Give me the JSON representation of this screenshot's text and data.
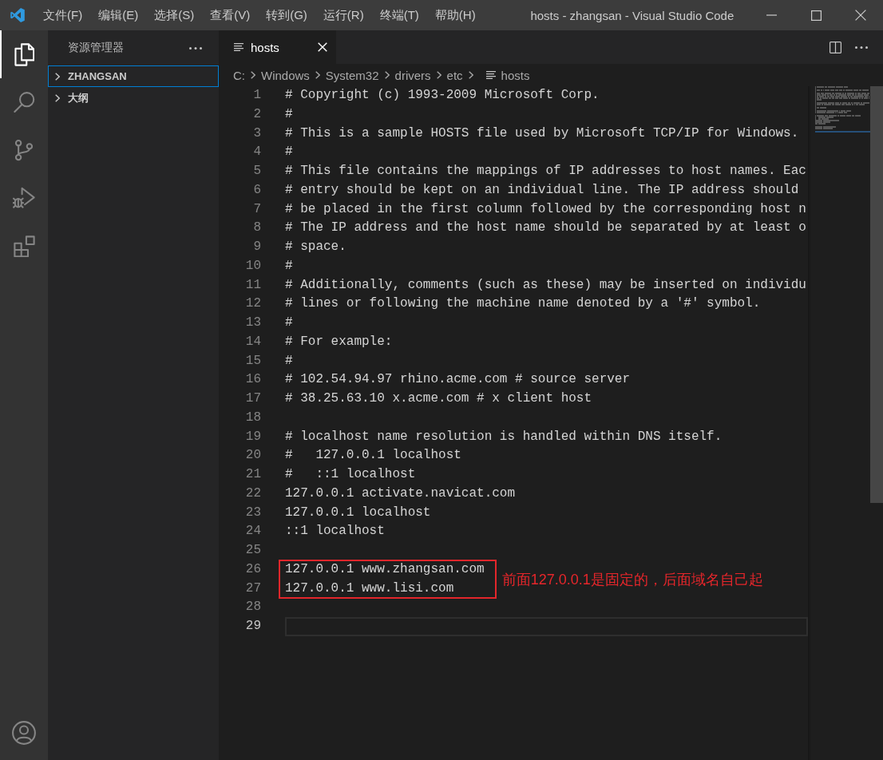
{
  "title_bar": {
    "menu": [
      "文件(F)",
      "编辑(E)",
      "选择(S)",
      "查看(V)",
      "转到(G)",
      "运行(R)",
      "终端(T)",
      "帮助(H)"
    ],
    "title": "hosts - zhangsan - Visual Studio Code"
  },
  "activity_bar": {
    "items": [
      {
        "kind": "explorer",
        "selected": true
      },
      {
        "kind": "search",
        "selected": false
      },
      {
        "kind": "source_control",
        "selected": false
      },
      {
        "kind": "run_debug",
        "selected": false
      },
      {
        "kind": "extensions",
        "selected": false
      }
    ]
  },
  "sidebar": {
    "title": "资源管理器",
    "sections": [
      {
        "label": "ZHANGSAN",
        "expanded": false,
        "selected": true
      },
      {
        "label": "大纲",
        "expanded": false,
        "selected": false
      }
    ]
  },
  "editor": {
    "tabs": [
      {
        "label": "hosts",
        "selected": true
      }
    ],
    "breadcrumb": [
      {
        "label": "C:",
        "kind": "folder"
      },
      {
        "label": "Windows",
        "kind": "folder"
      },
      {
        "label": "System32",
        "kind": "folder"
      },
      {
        "label": "drivers",
        "kind": "folder"
      },
      {
        "label": "etc",
        "kind": "folder"
      },
      {
        "label": "hosts",
        "kind": "file"
      }
    ],
    "lines": [
      {
        "number": "1",
        "text": "# Copyright (c) 1993-2009 Microsoft Corp.",
        "current": false,
        "boxed": false
      },
      {
        "number": "2",
        "text": "#",
        "current": false,
        "boxed": false
      },
      {
        "number": "3",
        "text": "# This is a sample HOSTS file used by Microsoft TCP/IP for Windows.",
        "current": false,
        "boxed": false
      },
      {
        "number": "4",
        "text": "#",
        "current": false,
        "boxed": false
      },
      {
        "number": "5",
        "text": "# This file contains the mappings of IP addresses to host names. Eac",
        "current": false,
        "boxed": false
      },
      {
        "number": "6",
        "text": "# entry should be kept on an individual line. The IP address should",
        "current": false,
        "boxed": false
      },
      {
        "number": "7",
        "text": "# be placed in the first column followed by the corresponding host n",
        "current": false,
        "boxed": false
      },
      {
        "number": "8",
        "text": "# The IP address and the host name should be separated by at least o",
        "current": false,
        "boxed": false
      },
      {
        "number": "9",
        "text": "# space.",
        "current": false,
        "boxed": false
      },
      {
        "number": "10",
        "text": "#",
        "current": false,
        "boxed": false
      },
      {
        "number": "11",
        "text": "# Additionally, comments (such as these) may be inserted on individu",
        "current": false,
        "boxed": false
      },
      {
        "number": "12",
        "text": "# lines or following the machine name denoted by a '#' symbol.",
        "current": false,
        "boxed": false
      },
      {
        "number": "13",
        "text": "#",
        "current": false,
        "boxed": false
      },
      {
        "number": "14",
        "text": "# For example:",
        "current": false,
        "boxed": false
      },
      {
        "number": "15",
        "text": "#",
        "current": false,
        "boxed": false
      },
      {
        "number": "16",
        "text": "# 102.54.94.97 rhino.acme.com # source server",
        "current": false,
        "boxed": false
      },
      {
        "number": "17",
        "text": "# 38.25.63.10 x.acme.com # x client host",
        "current": false,
        "boxed": false
      },
      {
        "number": "18",
        "current": false,
        "boxed": false
      },
      {
        "number": "19",
        "text": "# localhost name resolution is handled within DNS itself.",
        "current": false,
        "boxed": false
      },
      {
        "number": "20",
        "text": "#   127.0.0.1 localhost",
        "current": false,
        "boxed": false
      },
      {
        "number": "21",
        "text": "#   ::1 localhost",
        "current": false,
        "boxed": false
      },
      {
        "number": "22",
        "text": "127.0.0.1 activate.navicat.com",
        "current": false,
        "boxed": false
      },
      {
        "number": "23",
        "text": "127.0.0.1 localhost",
        "current": false,
        "boxed": false
      },
      {
        "number": "24",
        "text": "::1 localhost",
        "current": false,
        "boxed": false
      },
      {
        "number": "25",
        "current": false,
        "boxed": false
      },
      {
        "number": "26",
        "text": "127.0.0.1 www.zhangsan.com",
        "current": false,
        "boxed": true
      },
      {
        "number": "27",
        "text": "127.0.0.1 www.lisi.com",
        "current": false,
        "boxed": true
      },
      {
        "number": "28",
        "current": false,
        "boxed": false
      },
      {
        "number": "29",
        "current": true,
        "boxed": false
      }
    ],
    "annotation": {
      "text": "前面127.0.0.1是固定的，后面域名自己起"
    }
  }
}
